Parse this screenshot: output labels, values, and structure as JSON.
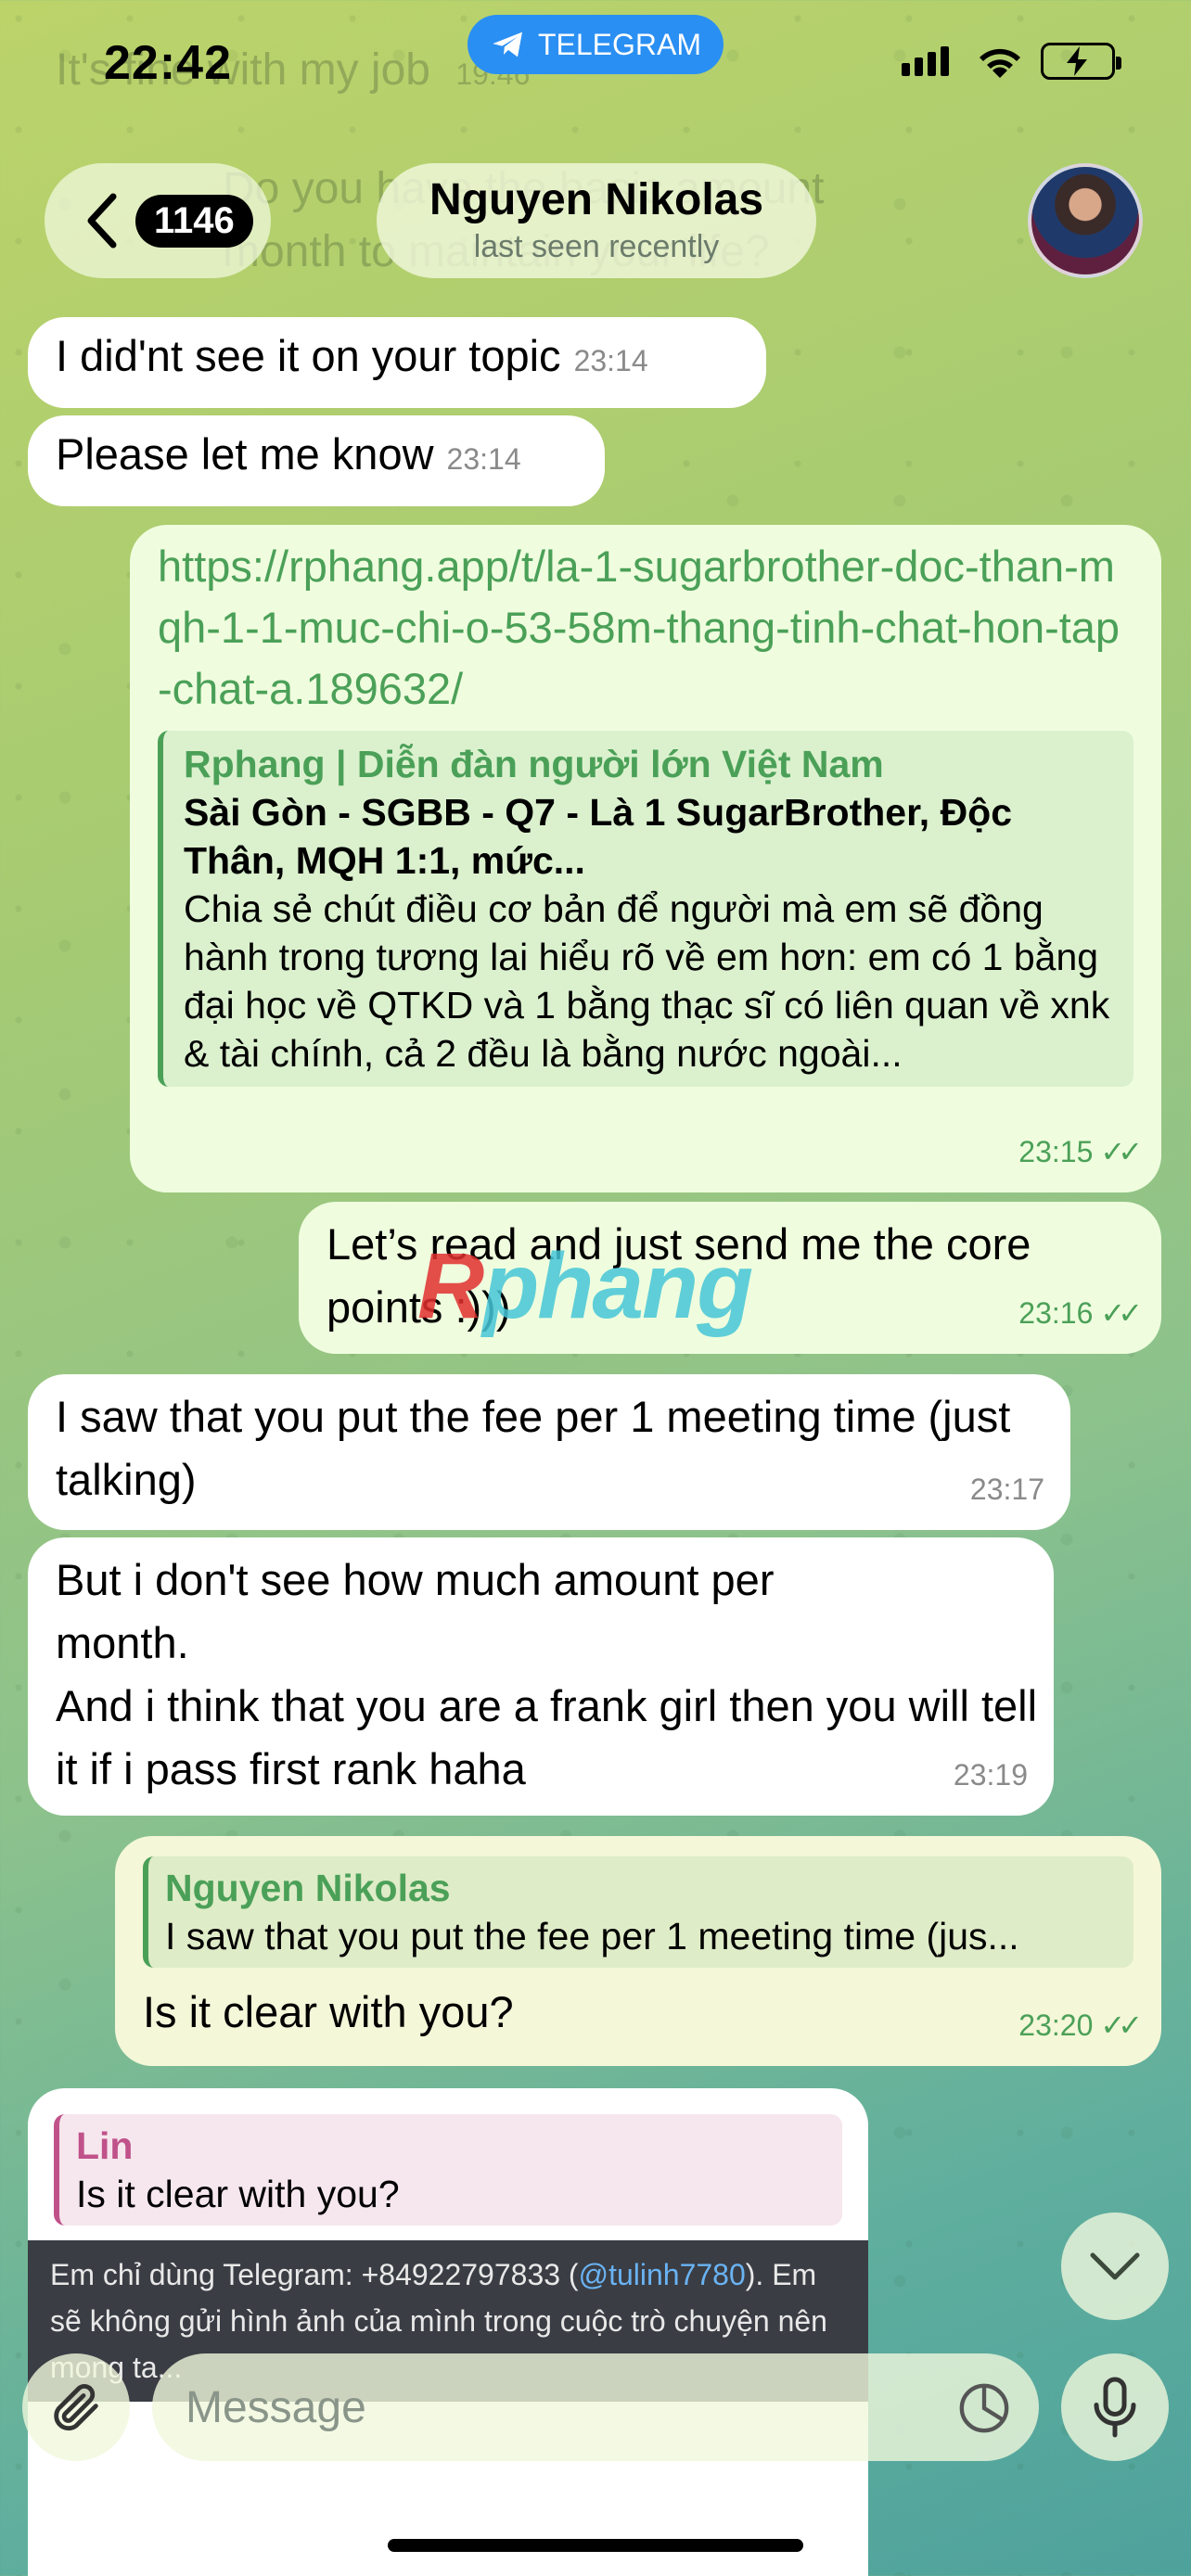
{
  "status": {
    "time": "22:42",
    "banner": "TELEGRAM"
  },
  "ghost": {
    "line1": "It's fine with my job",
    "line1_time": "19:46",
    "line2a": "Do you have the basic amount",
    "line2b": "month to maintain your life?",
    "line2_time": "19"
  },
  "header": {
    "unread": "1146",
    "name": "Nguyen Nikolas",
    "status": "last seen recently"
  },
  "messages": {
    "m1": {
      "text": "I did'nt see it on your topic",
      "time": "23:14"
    },
    "m2": {
      "text": "Please let me know",
      "time": "23:14"
    },
    "m3": {
      "link": "https://rphang.app/t/la-1-sugarbrother-doc-than-mqh-1-1-muc-chi-o-53-58m-thang-tinh-chat-hon-tap-chat-a.189632/",
      "site": "Rphang | Diễn đàn người lớn Việt Nam",
      "title": "Sài Gòn - SGBB - Q7 - Là 1 SugarBrother, Độc Thân, MQH 1:1, mức...",
      "desc": "Chia sẻ chút điều cơ bản để người mà em sẽ đồng hành trong tương lai hiểu rõ về em hơn: em có 1 bằng đại học về QTKD và 1 bằng thạc sĩ có liên quan về xnk & tài chính, cả 2 đều là bằng nước ngoài...",
      "time": "23:15"
    },
    "m4": {
      "text": "Let’s read and just send me the core points :)))",
      "time": "23:16"
    },
    "m5": {
      "text": "I saw that you put the fee per 1 meeting time (just talking)",
      "time": "23:17"
    },
    "m6": {
      "line1": "But i don't see how much amount per month.",
      "line2": "And i think that you are a frank girl then you will tell it if i pass first rank haha",
      "time": "23:19"
    },
    "m7": {
      "reply_name": "Nguyen Nikolas",
      "reply_text": "I saw that you put the fee per 1 meeting time (jus...",
      "text": "Is it clear with you?",
      "time": "23:20"
    },
    "m8": {
      "reply_name": "Lin",
      "reply_text": "Is it clear with you?",
      "panel_pre": "Em chỉ dùng Telegram: +84922797833 (",
      "panel_mention": "@tulinh7780",
      "panel_post": "). Em sẽ không gửi hình ảnh của mình trong cuộc trò chuyện nên mong ta..."
    }
  },
  "watermark": {
    "r": "R",
    "rest": "phang"
  },
  "input": {
    "placeholder": "Message"
  }
}
